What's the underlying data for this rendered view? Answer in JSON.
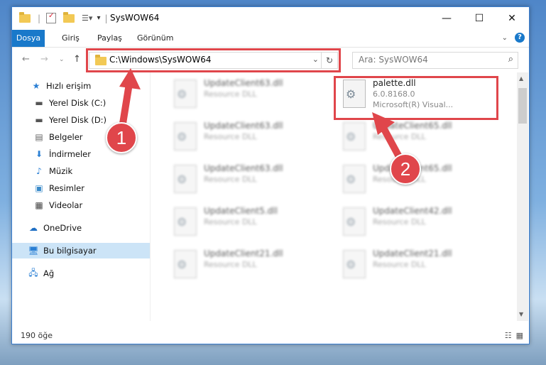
{
  "window": {
    "title": "SysWOW64"
  },
  "ribbon": {
    "tabs": [
      "Dosya",
      "Giriş",
      "Paylaş",
      "Görünüm"
    ]
  },
  "address": {
    "path": "C:\\Windows\\SysWOW64"
  },
  "search": {
    "placeholder": "Ara: SysWOW64"
  },
  "nav": {
    "items": [
      {
        "label": "Hızlı erişim",
        "icon": "star-icon"
      },
      {
        "label": "Yerel Disk (C:)",
        "icon": "drive-icon"
      },
      {
        "label": "Yerel Disk (D:)",
        "icon": "drive-icon"
      },
      {
        "label": "Belgeler",
        "icon": "documents-icon"
      },
      {
        "label": "İndirmeler",
        "icon": "download-icon"
      },
      {
        "label": "Müzik",
        "icon": "music-icon"
      },
      {
        "label": "Resimler",
        "icon": "pictures-icon"
      },
      {
        "label": "Videolar",
        "icon": "videos-icon"
      },
      {
        "label": "OneDrive",
        "icon": "cloud-icon"
      },
      {
        "label": "Bu bilgisayar",
        "icon": "computer-icon"
      },
      {
        "label": "Ağ",
        "icon": "network-icon"
      }
    ]
  },
  "files": {
    "highlight": {
      "name": "palette.dll",
      "version": "6.0.8168.0",
      "company": "Microsoft(R) Visual..."
    },
    "left": [
      {
        "name": "UpdateClient63.dll",
        "type": "Resource DLL"
      },
      {
        "name": "UpdateClient63.dll",
        "type": "Resource DLL"
      },
      {
        "name": "UpdateClient63.dll",
        "type": "Resource DLL"
      },
      {
        "name": "UpdateClient5.dll",
        "type": "Resource DLL"
      },
      {
        "name": "UpdateClient21.dll",
        "type": "Resource DLL"
      }
    ],
    "right": [
      {
        "name": "UpdateClient65.dll",
        "type": "Resource DLL"
      },
      {
        "name": "UpdateClient65.dll",
        "type": "Resource DLL"
      },
      {
        "name": "UpdateClient42.dll",
        "type": "Resource DLL"
      },
      {
        "name": "UpdateClient21.dll",
        "type": "Resource DLL"
      }
    ]
  },
  "status": {
    "count": "190 öğe"
  },
  "callouts": {
    "one": "1",
    "two": "2"
  },
  "colors": {
    "accent": "#1979ca",
    "highlight": "#e0464b",
    "selection": "#cce4f7"
  }
}
